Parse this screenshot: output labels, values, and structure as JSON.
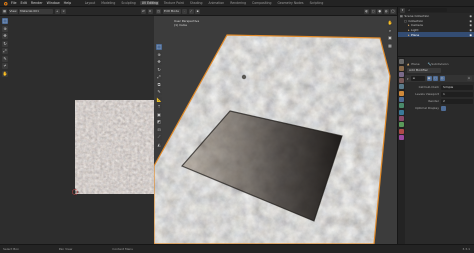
{
  "menu": [
    "File",
    "Edit",
    "Render",
    "Window",
    "Help"
  ],
  "workspace_tabs": [
    "Layout",
    "Modeling",
    "Sculpting",
    "UV Editing",
    "Texture Paint",
    "Shading",
    "Animation",
    "Rendering",
    "Compositing",
    "Geometry Nodes",
    "Scripting"
  ],
  "active_tab": "UV Editing",
  "image_editor": {
    "mode": "View",
    "image_name": "Material.001",
    "tools": [
      "select",
      "cursor",
      "move",
      "rotate",
      "scale",
      "annotate",
      "rip",
      "grab"
    ]
  },
  "viewport": {
    "mode": "Edit Mode",
    "view_info": "User Perspective",
    "object_info": "(1) Cube",
    "nav_icons": [
      "hand",
      "zoom",
      "camera",
      "grid"
    ],
    "tools": [
      "select",
      "cursor",
      "move",
      "rotate",
      "scale",
      "transform",
      "annotate",
      "measure",
      "extrude",
      "inset",
      "bevel",
      "loop-cut",
      "knife",
      "poly-build"
    ]
  },
  "outliner": {
    "header": "Scene Collection",
    "items": [
      {
        "label": "Scene Collection",
        "depth": 0,
        "selected": false
      },
      {
        "label": "Collection",
        "depth": 1,
        "selected": false
      },
      {
        "label": "Camera",
        "depth": 2,
        "selected": false
      },
      {
        "label": "Light",
        "depth": 2,
        "selected": false
      },
      {
        "label": "Plane",
        "depth": 2,
        "selected": true
      }
    ]
  },
  "properties": {
    "object_name": "Plane",
    "modifier_header": "Subdivision",
    "add_modifier": "Add Modifier",
    "rows": [
      {
        "label": "Catmull-Clark",
        "value": "Simple"
      },
      {
        "label": "Levels Viewport",
        "value": "1"
      },
      {
        "label": "Render",
        "value": "2"
      },
      {
        "label": "Optimal Display",
        "value": ""
      }
    ],
    "colors": {
      "accent": "#4f6d97",
      "selected": "#334c72"
    }
  },
  "status": {
    "left": "Select Box",
    "middle": "Pan View",
    "right": "Context Menu",
    "version": "3.3.1"
  }
}
